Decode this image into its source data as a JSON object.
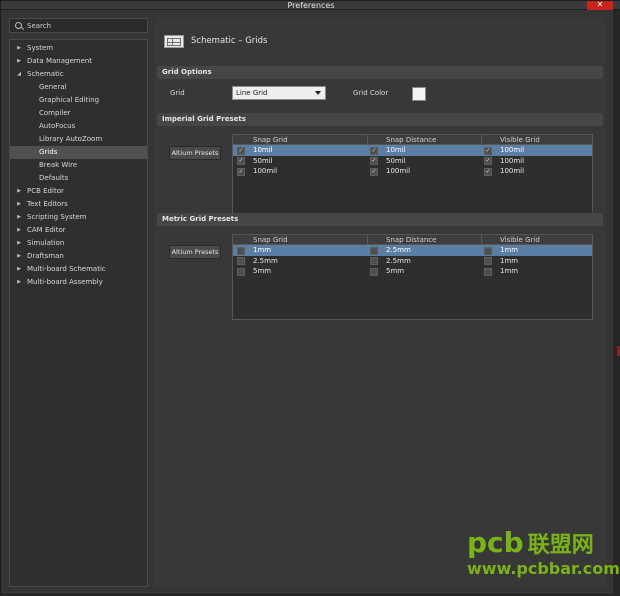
{
  "window": {
    "title": "Preferences",
    "close_glyph": "✕"
  },
  "search": {
    "placeholder": "Search"
  },
  "tree": [
    {
      "label": "System",
      "expand": "▶",
      "child": false,
      "selected": false
    },
    {
      "label": "Data Management",
      "expand": "▶",
      "child": false,
      "selected": false
    },
    {
      "label": "Schematic",
      "expand": "◢",
      "child": false,
      "selected": false
    },
    {
      "label": "General",
      "expand": "",
      "child": true,
      "selected": false
    },
    {
      "label": "Graphical Editing",
      "expand": "",
      "child": true,
      "selected": false
    },
    {
      "label": "Compiler",
      "expand": "",
      "child": true,
      "selected": false
    },
    {
      "label": "AutoFocus",
      "expand": "",
      "child": true,
      "selected": false
    },
    {
      "label": "Library AutoZoom",
      "expand": "",
      "child": true,
      "selected": false
    },
    {
      "label": "Grids",
      "expand": "",
      "child": true,
      "selected": true
    },
    {
      "label": "Break Wire",
      "expand": "",
      "child": true,
      "selected": false
    },
    {
      "label": "Defaults",
      "expand": "",
      "child": true,
      "selected": false
    },
    {
      "label": "PCB Editor",
      "expand": "▶",
      "child": false,
      "selected": false
    },
    {
      "label": "Text Editors",
      "expand": "▶",
      "child": false,
      "selected": false
    },
    {
      "label": "Scripting System",
      "expand": "▶",
      "child": false,
      "selected": false
    },
    {
      "label": "CAM Editor",
      "expand": "▶",
      "child": false,
      "selected": false
    },
    {
      "label": "Simulation",
      "expand": "▶",
      "child": false,
      "selected": false
    },
    {
      "label": "Draftsman",
      "expand": "▶",
      "child": false,
      "selected": false
    },
    {
      "label": "Multi-board Schematic",
      "expand": "▶",
      "child": false,
      "selected": false
    },
    {
      "label": "Multi-board Assembly",
      "expand": "▶",
      "child": false,
      "selected": false
    }
  ],
  "page": {
    "title": "Schematic – Grids"
  },
  "grid_options": {
    "section_title": "Grid Options",
    "grid_label": "Grid",
    "grid_value": "Line Grid",
    "color_label": "Grid Color",
    "color_value": "#f4f4f4"
  },
  "imperial": {
    "section_title": "Imperial Grid Presets",
    "button": "Altium Presets",
    "columns": [
      "Snap Grid",
      "Snap Distance",
      "Visible Grid"
    ],
    "rows": [
      {
        "selected": true,
        "cells": [
          {
            "checked": true,
            "value": "10mil"
          },
          {
            "checked": true,
            "value": "10mil"
          },
          {
            "checked": true,
            "value": "100mil"
          }
        ]
      },
      {
        "selected": false,
        "cells": [
          {
            "checked": true,
            "value": "50mil"
          },
          {
            "checked": true,
            "value": "50mil"
          },
          {
            "checked": true,
            "value": "100mil"
          }
        ]
      },
      {
        "selected": false,
        "cells": [
          {
            "checked": true,
            "value": "100mil"
          },
          {
            "checked": true,
            "value": "100mil"
          },
          {
            "checked": true,
            "value": "100mil"
          }
        ]
      }
    ]
  },
  "metric": {
    "section_title": "Metric Grid Presets",
    "button": "Altium Presets",
    "columns": [
      "Snap Grid",
      "Snap Distance",
      "Visible Grid"
    ],
    "rows": [
      {
        "selected": true,
        "cells": [
          {
            "checked": false,
            "value": "1mm"
          },
          {
            "checked": false,
            "value": "2.5mm"
          },
          {
            "checked": false,
            "value": "1mm"
          }
        ]
      },
      {
        "selected": false,
        "cells": [
          {
            "checked": false,
            "value": "2.5mm"
          },
          {
            "checked": false,
            "value": "2.5mm"
          },
          {
            "checked": false,
            "value": "1mm"
          }
        ]
      },
      {
        "selected": false,
        "cells": [
          {
            "checked": false,
            "value": "5mm"
          },
          {
            "checked": false,
            "value": "5mm"
          },
          {
            "checked": false,
            "value": "1mm"
          }
        ]
      }
    ]
  },
  "watermark": {
    "logo": "pcb",
    "logo_cn": "联盟网",
    "url": "www.pcbbar.com"
  }
}
